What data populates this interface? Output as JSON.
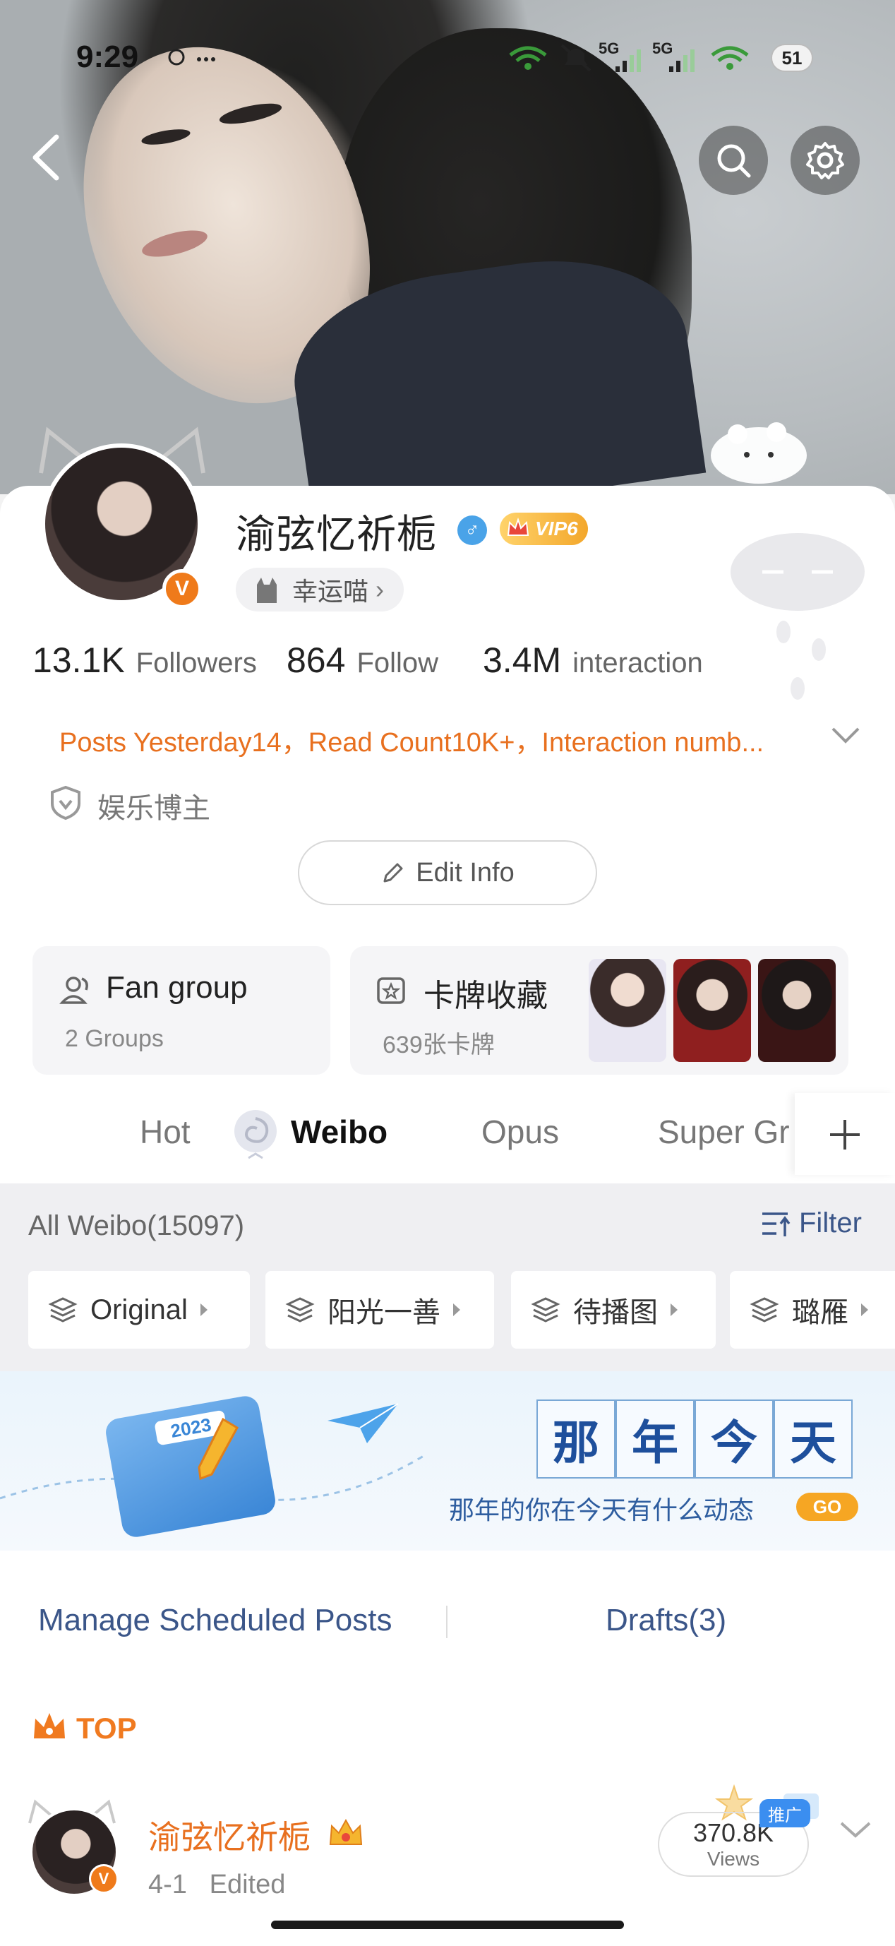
{
  "status_bar": {
    "time": "9:29",
    "battery": "51",
    "network_1": "5G",
    "network_2": "5G"
  },
  "profile": {
    "username": "渝弦忆祈栀",
    "vip_label": "VIP6",
    "tag_pill": "幸运喵",
    "verified_badge": "V",
    "gender_symbol": "♂"
  },
  "stats": {
    "followers_value": "13.1K",
    "followers_label": "Followers",
    "follow_value": "864",
    "follow_label": "Follow",
    "interaction_value": "3.4M",
    "interaction_label": "interaction"
  },
  "summary_line": "Posts Yesterday14，Read Count10K+，Interaction numb...",
  "category_label": "娱乐博主",
  "edit_info_label": "Edit Info",
  "fan_group": {
    "title": "Fan group",
    "subtitle": "2 Groups"
  },
  "card_collection": {
    "title": "卡牌收藏",
    "subtitle": "639张卡牌"
  },
  "tabs": [
    {
      "label": "Hot"
    },
    {
      "label": "Weibo"
    },
    {
      "label": "Opus"
    },
    {
      "label": "Super Gr"
    }
  ],
  "feed_header": {
    "all_label": "All Weibo(15097)",
    "filter_label": "Filter"
  },
  "filter_chips": [
    {
      "label": "Original"
    },
    {
      "label": "阳光一善"
    },
    {
      "label": "待播图"
    },
    {
      "label": "璐雁"
    }
  ],
  "banner": {
    "calendar_year": "2023",
    "title_chars": [
      "那",
      "年",
      "今",
      "天"
    ],
    "subtitle": "那年的你在今天有什么动态",
    "go_label": "GO"
  },
  "links": {
    "scheduled": "Manage Scheduled Posts",
    "drafts": "Drafts(3)"
  },
  "top_post": {
    "top_label": "TOP",
    "author": "渝弦忆祈栀",
    "meta": "4-1   Edited",
    "views_value": "370.8K",
    "views_label": "Views",
    "promo_label": "推广"
  },
  "colors": {
    "accent_orange": "#e8701f",
    "link_blue": "#3b5689",
    "vip_gold": "#f3a72b",
    "verified_orange": "#ef7a1a"
  }
}
